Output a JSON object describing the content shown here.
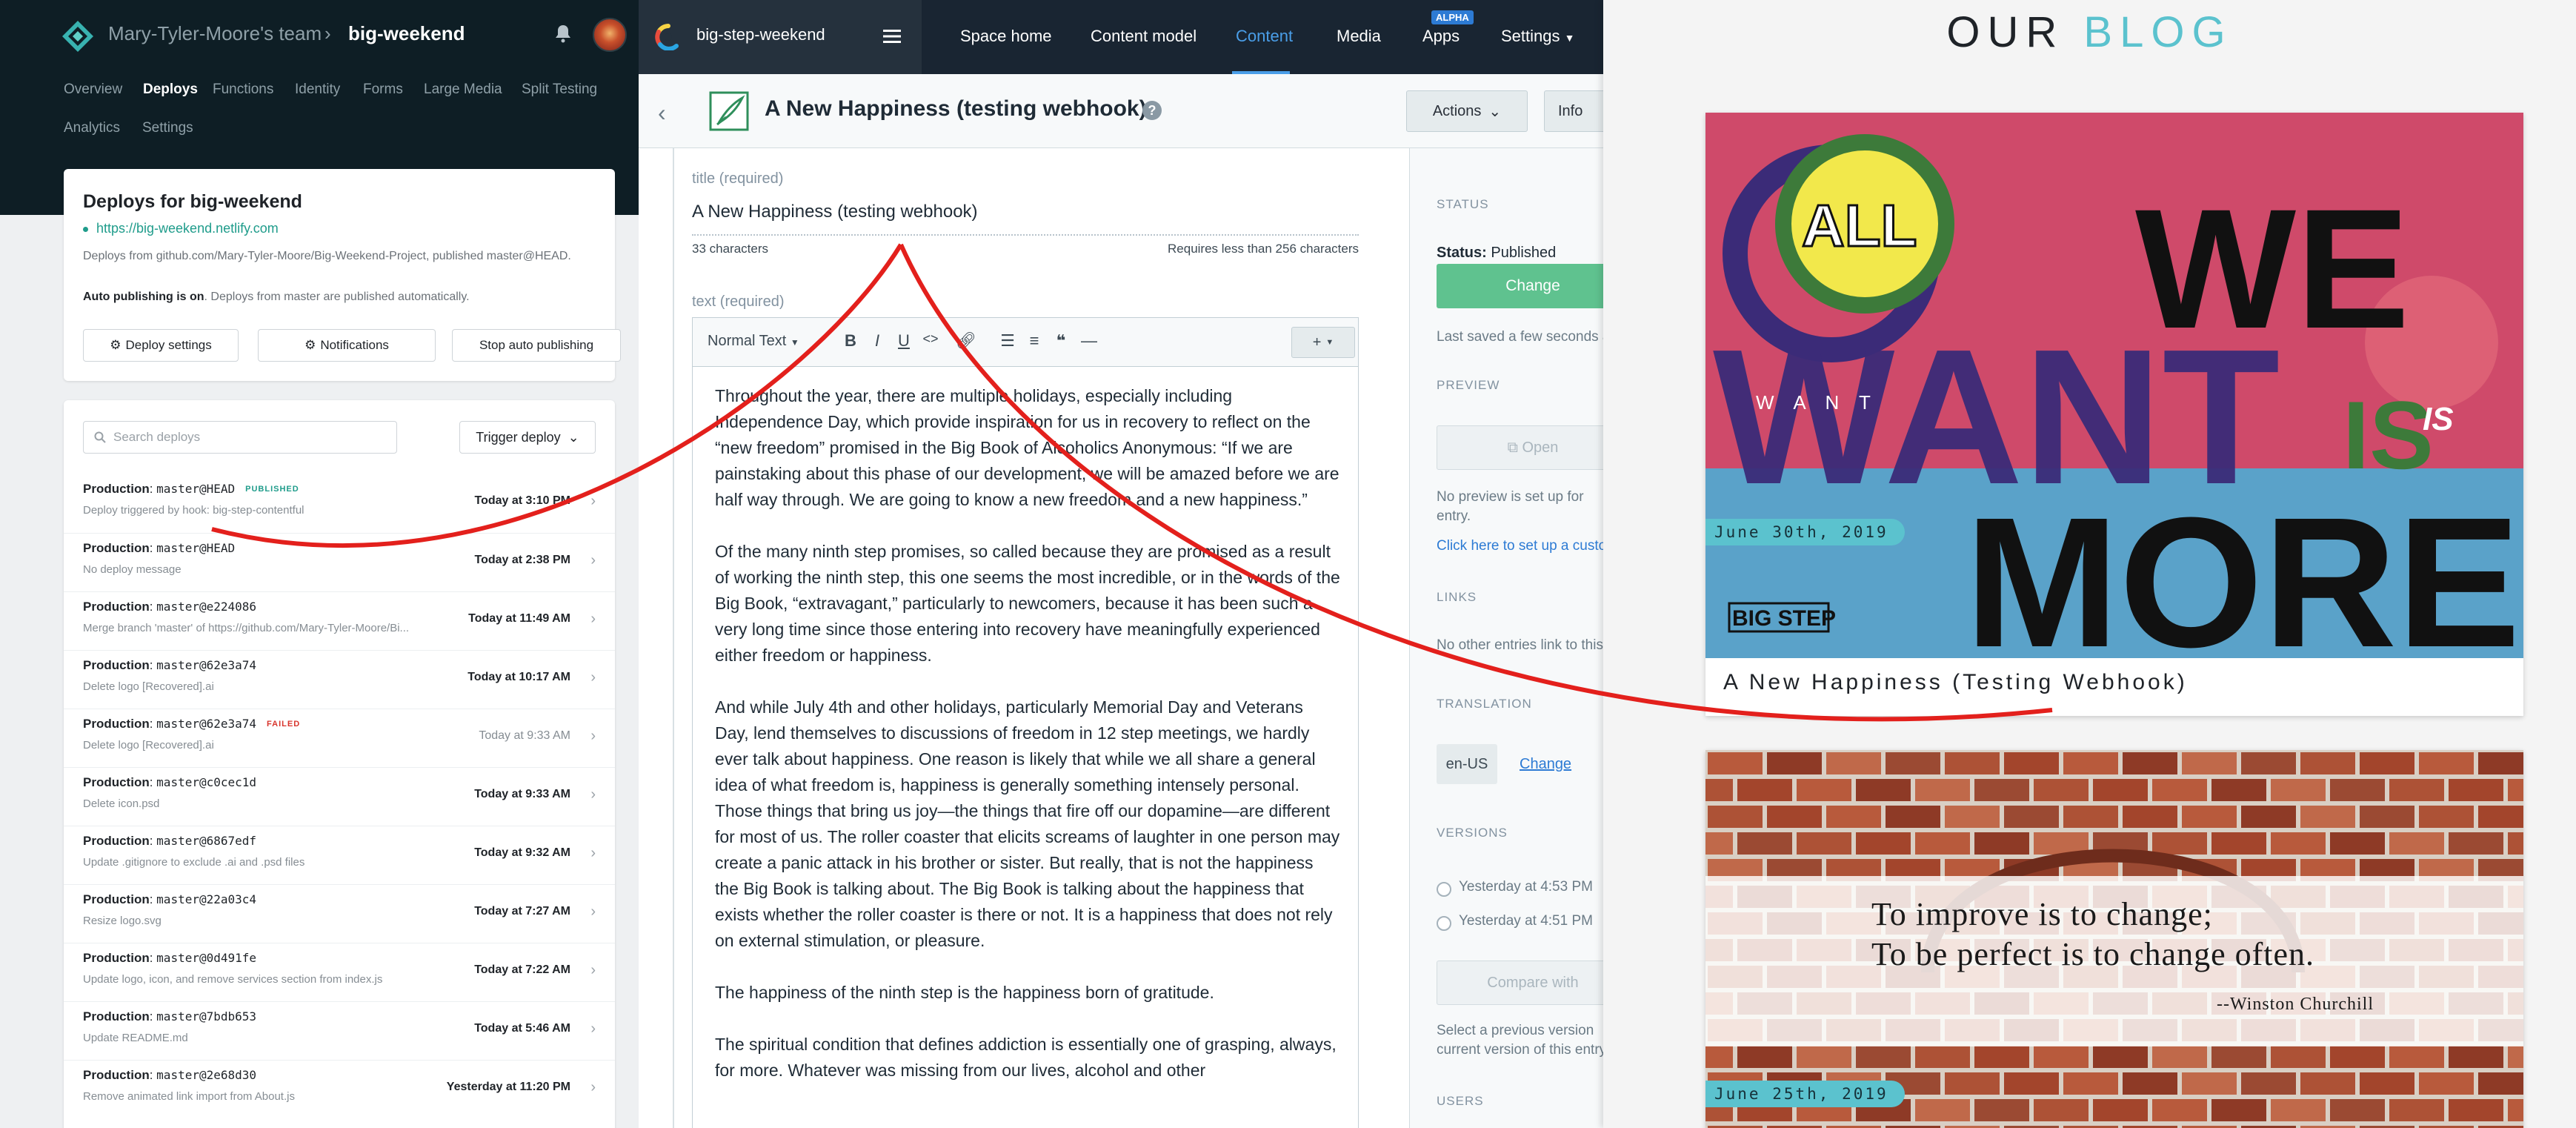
{
  "netlify": {
    "team": "Mary-Tyler-Moore's team",
    "separator": "›",
    "site": "big-weekend",
    "nav": [
      "Overview",
      "Deploys",
      "Functions",
      "Identity",
      "Forms",
      "Large Media",
      "Split Testing",
      "Analytics",
      "Settings"
    ],
    "active_nav": "Deploys",
    "card": {
      "title": "Deploys for big-weekend",
      "url": "https://big-weekend.netlify.com",
      "description": "Deploys from github.com/Mary-Tyler-Moore/Big-Weekend-Project, published master@HEAD.",
      "auto_bold": "Auto publishing is on",
      "auto_rest": ". Deploys from master are published automatically.",
      "buttons": [
        "Deploy settings",
        "Notifications",
        "Stop auto publishing"
      ]
    },
    "search_placeholder": "Search deploys",
    "trigger_label": "Trigger deploy",
    "deploys": [
      {
        "env": "Production",
        "ref": "master@HEAD",
        "badge": "PUBLISHED",
        "badge_type": "pub",
        "sub": "Deploy triggered by hook: big-step-contentful",
        "time": "Today at 3:10 PM",
        "bold": true
      },
      {
        "env": "Production",
        "ref": "master@HEAD",
        "badge": "",
        "badge_type": "",
        "sub": "No deploy message",
        "time": "Today at 2:38 PM",
        "bold": true
      },
      {
        "env": "Production",
        "ref": "master@e224086",
        "badge": "",
        "badge_type": "",
        "sub": "Merge branch 'master' of https://github.com/Mary-Tyler-Moore/Bi...",
        "time": "Today at 11:49 AM",
        "bold": true
      },
      {
        "env": "Production",
        "ref": "master@62e3a74",
        "badge": "",
        "badge_type": "",
        "sub": "Delete logo [Recovered].ai",
        "time": "Today at 10:17 AM",
        "bold": true
      },
      {
        "env": "Production",
        "ref": "master@62e3a74",
        "badge": "FAILED",
        "badge_type": "fail",
        "sub": "Delete logo [Recovered].ai",
        "time": "Today at 9:33 AM",
        "bold": false
      },
      {
        "env": "Production",
        "ref": "master@c0cec1d",
        "badge": "",
        "badge_type": "",
        "sub": "Delete icon.psd",
        "time": "Today at 9:33 AM",
        "bold": true
      },
      {
        "env": "Production",
        "ref": "master@6867edf",
        "badge": "",
        "badge_type": "",
        "sub": "Update .gitignore to exclude .ai and .psd files",
        "time": "Today at 9:32 AM",
        "bold": true
      },
      {
        "env": "Production",
        "ref": "master@22a03c4",
        "badge": "",
        "badge_type": "",
        "sub": "Resize logo.svg",
        "time": "Today at 7:27 AM",
        "bold": true
      },
      {
        "env": "Production",
        "ref": "master@0d491fe",
        "badge": "",
        "badge_type": "",
        "sub": "Update logo, icon, and remove services section from index.js",
        "time": "Today at 7:22 AM",
        "bold": true
      },
      {
        "env": "Production",
        "ref": "master@7bdb653",
        "badge": "",
        "badge_type": "",
        "sub": "Update README.md",
        "time": "Today at 5:46 AM",
        "bold": true
      },
      {
        "env": "Production",
        "ref": "master@2e68d30",
        "badge": "",
        "badge_type": "",
        "sub": "Remove animated link import from About.js",
        "time": "Yesterday at 11:20 PM",
        "bold": true
      }
    ]
  },
  "contentful": {
    "space": "big-step-weekend",
    "nav": [
      "Space home",
      "Content model",
      "Content",
      "Media",
      "Apps",
      "Settings"
    ],
    "active_nav": "Content",
    "alpha": "ALPHA",
    "entry_title": "A New Happiness (testing webhook)",
    "actions": "Actions",
    "info": "Info",
    "title_label": "title (required)",
    "title_value": "A New Happiness (testing webhook)",
    "title_count": "33 characters",
    "title_req": "Requires less than 256 characters",
    "text_label": "text (required)",
    "format": "Normal Text",
    "body": [
      "Throughout the year, there are multiple holidays, especially including Independence Day, which provide inspiration for us in recovery to reflect on the “new freedom” promised in the Big Book of Alcoholics Anonymous: “If we are painstaking about this phase of our development, we will be amazed before we are half way through. We are going to know a new freedom and a new happiness.”",
      " Of the many ninth step promises, so called because they are promised as a result of working the ninth step, this one seems the most incredible, or in the words of the Big Book, “extravagant,” particularly to newcomers, because it has been such a very long time since those entering into recovery have meaningfully experienced either freedom or happiness.",
      " And while July 4th and other holidays, particularly Memorial Day and Veterans Day, lend themselves to discussions of freedom in 12 step meetings, we hardly ever talk about happiness. One reason is likely that while we all share a general idea of what freedom is, happiness is generally something intensely personal. Those things that bring us joy—the things that fire off our dopamine—are different for most of us. The roller coaster that elicits screams of laughter in one person may create a panic attack in his brother or sister. But really, that is not the happiness the Big Book is talking about. The Big Book is talking about the happiness that exists whether the roller coaster is there or not. It is a happiness that does not rely on external stimulation, or pleasure.",
      " The happiness of the ninth step is the happiness born of gratitude.",
      " The spiritual condition that defines addiction is essentially one of grasping, always, for more. Whatever was missing from our lives, alcohol and other"
    ],
    "sidebar": {
      "status_h": "STATUS",
      "status_label": "Status:",
      "status_value": "Published",
      "change": "Change",
      "saved": "Last saved a few seconds ago",
      "preview_h": "PREVIEW",
      "open": "Open",
      "no_preview": "No preview is set up for",
      "no_preview2": "entry.",
      "setup_link": "Click here to set up a custom",
      "links_h": "LINKS",
      "links_text": "No other entries link to this",
      "translation_h": "TRANSLATION",
      "locale": "en-US",
      "locale_change": "Change",
      "versions_h": "VERSIONS",
      "versions": [
        "Yesterday at 4:53 PM",
        "Yesterday at 4:51 PM"
      ],
      "compare": "Compare with",
      "compare_desc1": "Select a previous version",
      "compare_desc2": "current version of this entry",
      "users_h": "USERS"
    }
  },
  "blog": {
    "title_a": "OUR ",
    "title_b": "BLOG",
    "posts": [
      {
        "date": "June 30th, 2019",
        "title": "A New Happiness (Testing Webhook)"
      },
      {
        "date": "June 25th, 2019",
        "quote1": "To improve is to change;",
        "quote2": "To be perfect is to change often.",
        "author": "--Winston Churchill"
      }
    ],
    "post1_art": {
      "all": "ALL",
      "we": "WE",
      "want": "WANT",
      "is": "IS",
      "more": "MORE",
      "want_small": "W A N T",
      "is_small": "IS",
      "bigstep": "BIG STEP"
    }
  },
  "colors": {
    "netlify_dark": "#0e1e25",
    "netlify_teal": "#1f9c8b",
    "contentful_nav": "#192532",
    "contentful_blue": "#4a9ee8",
    "publish_green": "#5fc28f",
    "blog_accent": "#5bc2ce",
    "arrow": "#e3201c"
  }
}
